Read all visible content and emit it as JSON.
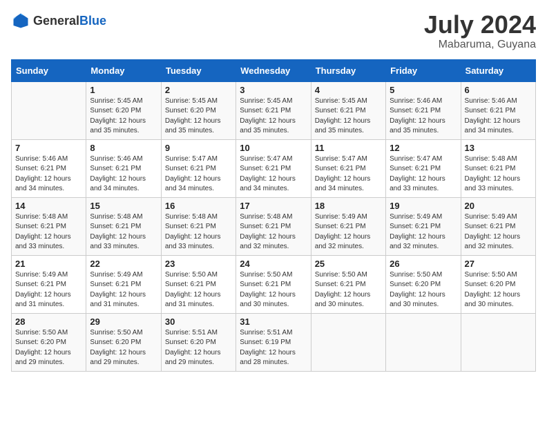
{
  "header": {
    "logo_general": "General",
    "logo_blue": "Blue",
    "month_title": "July 2024",
    "location": "Mabaruma, Guyana"
  },
  "days_of_week": [
    "Sunday",
    "Monday",
    "Tuesday",
    "Wednesday",
    "Thursday",
    "Friday",
    "Saturday"
  ],
  "weeks": [
    [
      {
        "day": "",
        "info": ""
      },
      {
        "day": "1",
        "info": "Sunrise: 5:45 AM\nSunset: 6:20 PM\nDaylight: 12 hours\nand 35 minutes."
      },
      {
        "day": "2",
        "info": "Sunrise: 5:45 AM\nSunset: 6:20 PM\nDaylight: 12 hours\nand 35 minutes."
      },
      {
        "day": "3",
        "info": "Sunrise: 5:45 AM\nSunset: 6:21 PM\nDaylight: 12 hours\nand 35 minutes."
      },
      {
        "day": "4",
        "info": "Sunrise: 5:45 AM\nSunset: 6:21 PM\nDaylight: 12 hours\nand 35 minutes."
      },
      {
        "day": "5",
        "info": "Sunrise: 5:46 AM\nSunset: 6:21 PM\nDaylight: 12 hours\nand 35 minutes."
      },
      {
        "day": "6",
        "info": "Sunrise: 5:46 AM\nSunset: 6:21 PM\nDaylight: 12 hours\nand 34 minutes."
      }
    ],
    [
      {
        "day": "7",
        "info": "Sunrise: 5:46 AM\nSunset: 6:21 PM\nDaylight: 12 hours\nand 34 minutes."
      },
      {
        "day": "8",
        "info": "Sunrise: 5:46 AM\nSunset: 6:21 PM\nDaylight: 12 hours\nand 34 minutes."
      },
      {
        "day": "9",
        "info": "Sunrise: 5:47 AM\nSunset: 6:21 PM\nDaylight: 12 hours\nand 34 minutes."
      },
      {
        "day": "10",
        "info": "Sunrise: 5:47 AM\nSunset: 6:21 PM\nDaylight: 12 hours\nand 34 minutes."
      },
      {
        "day": "11",
        "info": "Sunrise: 5:47 AM\nSunset: 6:21 PM\nDaylight: 12 hours\nand 34 minutes."
      },
      {
        "day": "12",
        "info": "Sunrise: 5:47 AM\nSunset: 6:21 PM\nDaylight: 12 hours\nand 33 minutes."
      },
      {
        "day": "13",
        "info": "Sunrise: 5:48 AM\nSunset: 6:21 PM\nDaylight: 12 hours\nand 33 minutes."
      }
    ],
    [
      {
        "day": "14",
        "info": "Sunrise: 5:48 AM\nSunset: 6:21 PM\nDaylight: 12 hours\nand 33 minutes."
      },
      {
        "day": "15",
        "info": "Sunrise: 5:48 AM\nSunset: 6:21 PM\nDaylight: 12 hours\nand 33 minutes."
      },
      {
        "day": "16",
        "info": "Sunrise: 5:48 AM\nSunset: 6:21 PM\nDaylight: 12 hours\nand 33 minutes."
      },
      {
        "day": "17",
        "info": "Sunrise: 5:48 AM\nSunset: 6:21 PM\nDaylight: 12 hours\nand 32 minutes."
      },
      {
        "day": "18",
        "info": "Sunrise: 5:49 AM\nSunset: 6:21 PM\nDaylight: 12 hours\nand 32 minutes."
      },
      {
        "day": "19",
        "info": "Sunrise: 5:49 AM\nSunset: 6:21 PM\nDaylight: 12 hours\nand 32 minutes."
      },
      {
        "day": "20",
        "info": "Sunrise: 5:49 AM\nSunset: 6:21 PM\nDaylight: 12 hours\nand 32 minutes."
      }
    ],
    [
      {
        "day": "21",
        "info": "Sunrise: 5:49 AM\nSunset: 6:21 PM\nDaylight: 12 hours\nand 31 minutes."
      },
      {
        "day": "22",
        "info": "Sunrise: 5:49 AM\nSunset: 6:21 PM\nDaylight: 12 hours\nand 31 minutes."
      },
      {
        "day": "23",
        "info": "Sunrise: 5:50 AM\nSunset: 6:21 PM\nDaylight: 12 hours\nand 31 minutes."
      },
      {
        "day": "24",
        "info": "Sunrise: 5:50 AM\nSunset: 6:21 PM\nDaylight: 12 hours\nand 30 minutes."
      },
      {
        "day": "25",
        "info": "Sunrise: 5:50 AM\nSunset: 6:21 PM\nDaylight: 12 hours\nand 30 minutes."
      },
      {
        "day": "26",
        "info": "Sunrise: 5:50 AM\nSunset: 6:20 PM\nDaylight: 12 hours\nand 30 minutes."
      },
      {
        "day": "27",
        "info": "Sunrise: 5:50 AM\nSunset: 6:20 PM\nDaylight: 12 hours\nand 30 minutes."
      }
    ],
    [
      {
        "day": "28",
        "info": "Sunrise: 5:50 AM\nSunset: 6:20 PM\nDaylight: 12 hours\nand 29 minutes."
      },
      {
        "day": "29",
        "info": "Sunrise: 5:50 AM\nSunset: 6:20 PM\nDaylight: 12 hours\nand 29 minutes."
      },
      {
        "day": "30",
        "info": "Sunrise: 5:51 AM\nSunset: 6:20 PM\nDaylight: 12 hours\nand 29 minutes."
      },
      {
        "day": "31",
        "info": "Sunrise: 5:51 AM\nSunset: 6:19 PM\nDaylight: 12 hours\nand 28 minutes."
      },
      {
        "day": "",
        "info": ""
      },
      {
        "day": "",
        "info": ""
      },
      {
        "day": "",
        "info": ""
      }
    ]
  ]
}
